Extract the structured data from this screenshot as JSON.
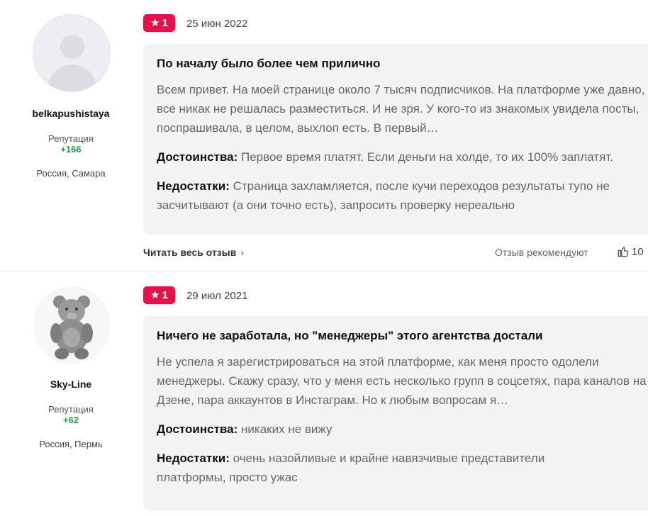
{
  "reviews": [
    {
      "author": "belkapushistaya",
      "reputation_label": "Репутация",
      "reputation": "+166",
      "location": "Россия, Самара",
      "rating": "1",
      "date": "25 июн 2022",
      "title": "По началу было более чем прилично",
      "body": "Всем привет. На моей странице около 7 тысяч подписчиков. На платформе уже давно, но все никак не решалась разместиться. И не зря. У кого-то из знакомых увидела посты, поспрашивала, в целом, выхлоп есть. В первый…",
      "pros_label": "Достоинства:",
      "pros": "Первое время платят. Если деньги на холде, то их 100% заплатят.",
      "cons_label": "Недостатки:",
      "cons": "Страница захламляется, после кучи переходов результаты тупо не засчитывают (а они точно есть), запросить проверку нереально",
      "read_more": "Читать весь отзыв",
      "recommend": "Отзыв рекомендуют",
      "likes": "10"
    },
    {
      "author": "Sky-Line",
      "reputation_label": "Репутация",
      "reputation": "+62",
      "location": "Россия, Пермь",
      "rating": "1",
      "date": "29 июл 2021",
      "title": "Ничего не заработала, но \"менеджеры\" этого агентства достали",
      "body": "Не успела я зарегистрироваться на этой платформе, как меня просто одолели менеджеры. Скажу сразу, что у меня есть несколько групп в соцсетях, пара каналов на Дзене, пара аккаунтов в Инстаграм. Но к любым вопросам я…",
      "pros_label": "Достоинства:",
      "pros": "никаких не вижу",
      "cons_label": "Недостатки:",
      "cons": "очень назойливые и крайне навязчивые представители платформы, просто ужас"
    }
  ],
  "colors": {
    "rating_badge": "#e4124a",
    "reputation": "#23a33b",
    "card_bg": "#f3f3f6"
  },
  "icons": {
    "rating": "star-icon",
    "read_more": "chevron-right-icon",
    "likes": "thumbs-up-icon"
  }
}
